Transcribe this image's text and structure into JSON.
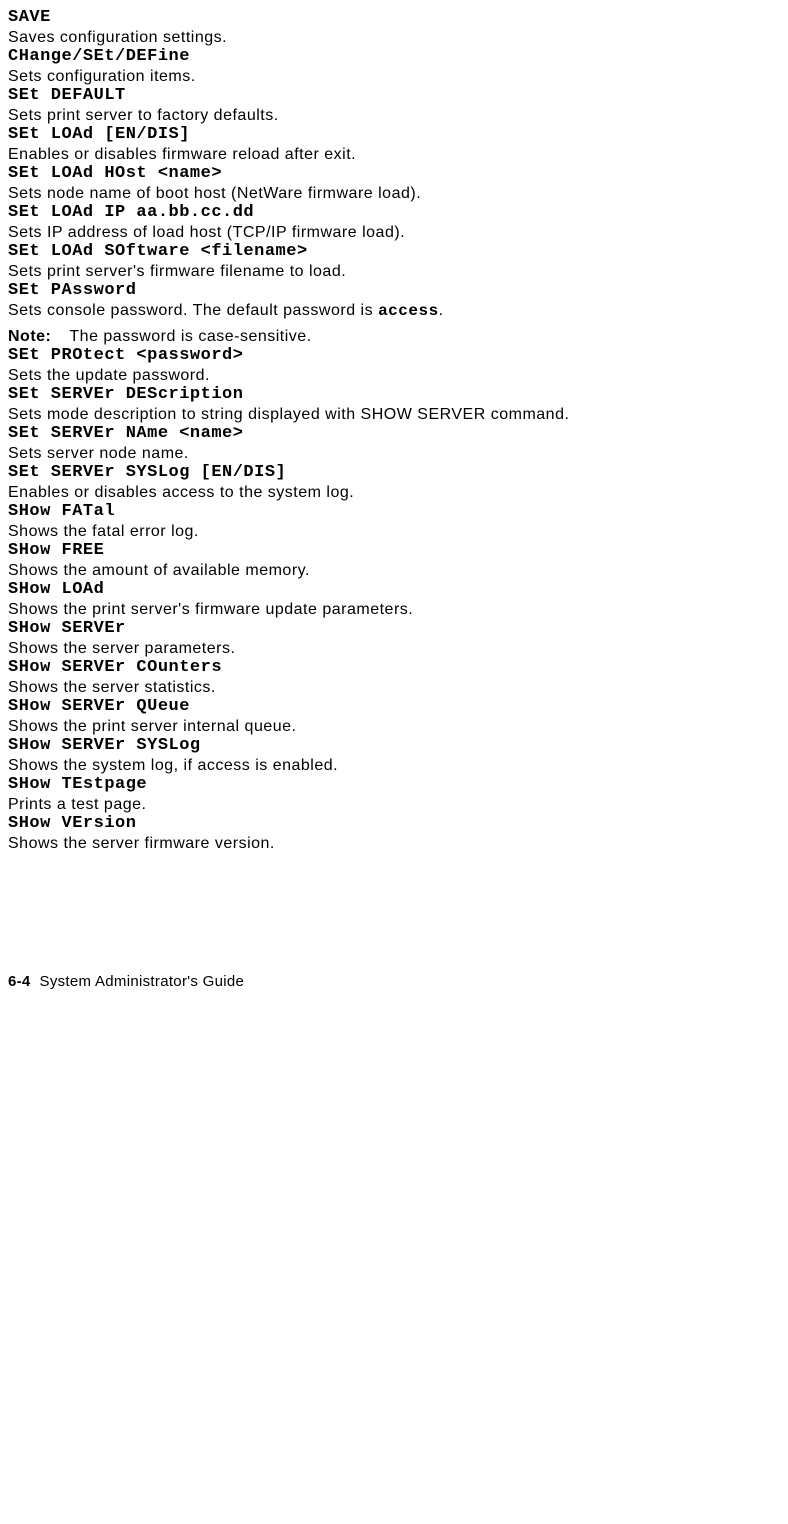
{
  "commands": [
    {
      "cmd": "SAVE",
      "desc": "Saves configuration settings."
    },
    {
      "cmd": "CHange/SEt/DEFine",
      "desc": "Sets configuration items."
    },
    {
      "cmd": "SEt DEFAULT",
      "desc": "Sets print server to factory defaults."
    },
    {
      "cmd": "SEt LOAd [EN/DIS]",
      "desc": "Enables or disables firmware reload after exit."
    },
    {
      "cmd": "SEt LOAd HOst <name>",
      "desc": "Sets node name of boot host (NetWare firmware load)."
    },
    {
      "cmd": "SEt LOAd IP aa.bb.cc.dd",
      "desc": "Sets IP address of load host (TCP/IP firmware load)."
    },
    {
      "cmd": "SEt LOAd SOftware <filename>",
      "desc": "Sets print server's firmware filename to load."
    },
    {
      "cmd": "SEt PAssword",
      "desc_pre": "Sets console password. The default password is ",
      "desc_code": "access",
      "desc_post": ".",
      "note_label": "Note:",
      "note_text": "The password is case-sensitive."
    },
    {
      "cmd": "SEt PROtect <password>",
      "desc": "Sets the update password."
    },
    {
      "cmd": "SEt SERVEr DEScription",
      "desc": "Sets mode description to string displayed with SHOW SERVER command."
    },
    {
      "cmd": "SEt SERVEr NAme <name>",
      "desc": "Sets server node name."
    },
    {
      "cmd": "SEt SERVEr SYSLog [EN/DIS]",
      "desc": "Enables or disables access to the system log."
    },
    {
      "cmd": "SHow FATal",
      "desc": "Shows the fatal error log."
    },
    {
      "cmd": "SHow FREE",
      "desc": "Shows the amount of available memory."
    },
    {
      "cmd": "SHow LOAd",
      "desc": "Shows the print server's firmware update parameters."
    },
    {
      "cmd": "SHow SERVEr",
      "desc": "Shows the server parameters."
    },
    {
      "cmd": "SHow SERVEr COunters",
      "desc": "Shows the server statistics."
    },
    {
      "cmd": "SHow SERVEr QUeue",
      "desc": "Shows the print server internal queue."
    },
    {
      "cmd": "SHow SERVEr SYSLog",
      "desc": "Shows the system log, if access is enabled."
    },
    {
      "cmd": "SHow TEstpage",
      "desc": "Prints a test page."
    },
    {
      "cmd": "SHow VErsion",
      "desc": "Shows the server firmware version."
    }
  ],
  "footer": {
    "page": "6-4",
    "title": "System Administrator's Guide"
  }
}
